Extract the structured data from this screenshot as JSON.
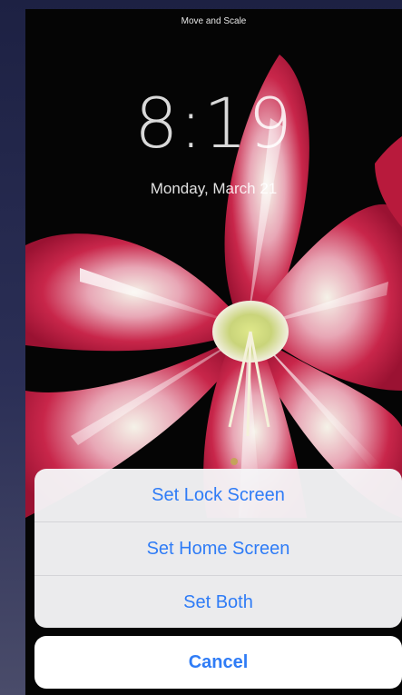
{
  "header": {
    "mode_title": "Move and Scale"
  },
  "lock_screen_preview": {
    "time": "8:19",
    "date": "Monday, March 21",
    "wallpaper_subject": "red-white-amaryllis-flower"
  },
  "action_sheet": {
    "options": [
      {
        "label": "Set Lock Screen"
      },
      {
        "label": "Set Home Screen"
      },
      {
        "label": "Set Both"
      }
    ],
    "cancel_label": "Cancel"
  },
  "colors": {
    "accent": "#2f7cf6",
    "sheet_background": "#f5f5f7",
    "backdrop": "#1d2143"
  }
}
